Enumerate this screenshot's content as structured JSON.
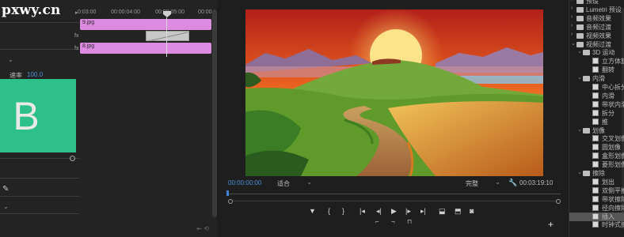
{
  "brand": {
    "logo": "pxwy.cn",
    "tile_letter": "B",
    "tile_color": "#2dc08a"
  },
  "left_panel": {
    "param_label": "速率",
    "param_value": "100.0"
  },
  "timeline": {
    "ruler": [
      "0:03:00",
      "00:00:04:00",
      "00:00:05:00",
      "00:00"
    ],
    "track_labels": [
      "fx",
      "fx"
    ],
    "clips": [
      {
        "label": "9.jpg"
      },
      {
        "label": "8.jpg"
      }
    ],
    "clip_color": "#dd8be0"
  },
  "monitor": {
    "timecode_current": "00:00:00:00",
    "fit": "适合",
    "quality": "完整",
    "timecode_duration": "00:03:19:10",
    "playhead_color": "#3c84d6",
    "controls": [
      "marker-icon",
      "in-point-icon",
      "out-point-icon",
      "go-to-in-icon",
      "step-back-icon",
      "play-icon",
      "step-forward-icon",
      "go-to-out-icon",
      "lift-icon",
      "extract-icon",
      "export-frame-icon"
    ]
  },
  "effects": {
    "items": [
      {
        "kind": "folder",
        "level": 1,
        "label": "预设"
      },
      {
        "kind": "folder",
        "level": 1,
        "label": "Lumetri 预设"
      },
      {
        "kind": "folder",
        "level": 1,
        "label": "音频效果"
      },
      {
        "kind": "folder",
        "level": 1,
        "label": "音频过渡"
      },
      {
        "kind": "folder",
        "level": 1,
        "label": "视频效果"
      },
      {
        "kind": "folder-open",
        "level": 1,
        "label": "视频过渡"
      },
      {
        "kind": "folder-open",
        "level": 2,
        "label": "3D 运动"
      },
      {
        "kind": "leaf",
        "level": 3,
        "label": "立方体旋转"
      },
      {
        "kind": "leaf",
        "level": 3,
        "label": "翻转"
      },
      {
        "kind": "folder-open",
        "level": 2,
        "label": "内滑"
      },
      {
        "kind": "leaf",
        "level": 3,
        "label": "中心拆分"
      },
      {
        "kind": "leaf",
        "level": 3,
        "label": "内滑"
      },
      {
        "kind": "leaf",
        "level": 3,
        "label": "带状内滑"
      },
      {
        "kind": "leaf",
        "level": 3,
        "label": "拆分"
      },
      {
        "kind": "leaf",
        "level": 3,
        "label": "推"
      },
      {
        "kind": "folder-open",
        "level": 2,
        "label": "划像"
      },
      {
        "kind": "leaf",
        "level": 3,
        "label": "交叉划像"
      },
      {
        "kind": "leaf",
        "level": 3,
        "label": "圆划像"
      },
      {
        "kind": "leaf",
        "level": 3,
        "label": "盒形划像"
      },
      {
        "kind": "leaf",
        "level": 3,
        "label": "菱形划像"
      },
      {
        "kind": "folder-open",
        "level": 2,
        "label": "擦除"
      },
      {
        "kind": "leaf",
        "level": 3,
        "label": "划出"
      },
      {
        "kind": "leaf",
        "level": 3,
        "label": "双侧平推门"
      },
      {
        "kind": "leaf",
        "level": 3,
        "label": "带状擦除"
      },
      {
        "kind": "leaf",
        "level": 3,
        "label": "径向擦除"
      },
      {
        "kind": "leaf",
        "level": 3,
        "label": "插入",
        "selected": true
      },
      {
        "kind": "leaf",
        "level": 3,
        "label": "时钟式擦除"
      }
    ]
  }
}
